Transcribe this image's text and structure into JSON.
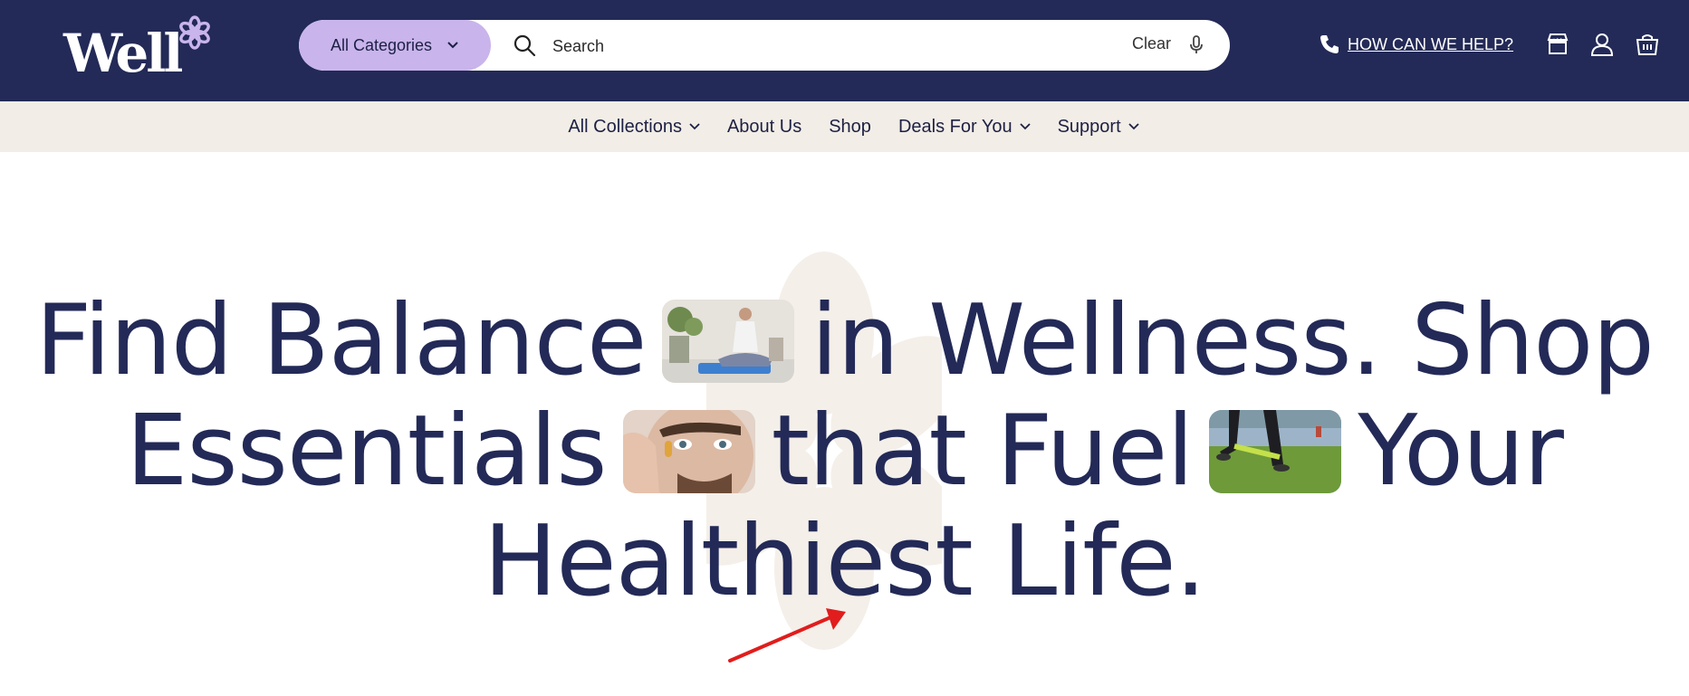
{
  "header": {
    "logo_text": "Well",
    "category_button": "All Categories",
    "search_placeholder": "Search",
    "clear_label": "Clear",
    "help_link": "HOW CAN WE HELP?",
    "colors": {
      "bar": "#232a57",
      "accent": "#c9b4ec"
    },
    "icons": [
      "phone-icon",
      "store-icon",
      "account-icon",
      "cart-icon"
    ]
  },
  "nav": {
    "items": [
      {
        "label": "All Collections",
        "has_dropdown": true
      },
      {
        "label": "About Us",
        "has_dropdown": false
      },
      {
        "label": "Shop",
        "has_dropdown": false
      },
      {
        "label": "Deals For You",
        "has_dropdown": true
      },
      {
        "label": "Support",
        "has_dropdown": true
      }
    ]
  },
  "hero": {
    "line1_a": "Find Balance",
    "line1_b": "in Wellness. Shop",
    "line2_a": "Essentials",
    "line2_b": "that Fuel",
    "line2_c": "Your",
    "line3": "Healthiest Life.",
    "images": [
      "meditation-photo",
      "supplement-capsule-photo",
      "resistance-band-photo"
    ]
  }
}
